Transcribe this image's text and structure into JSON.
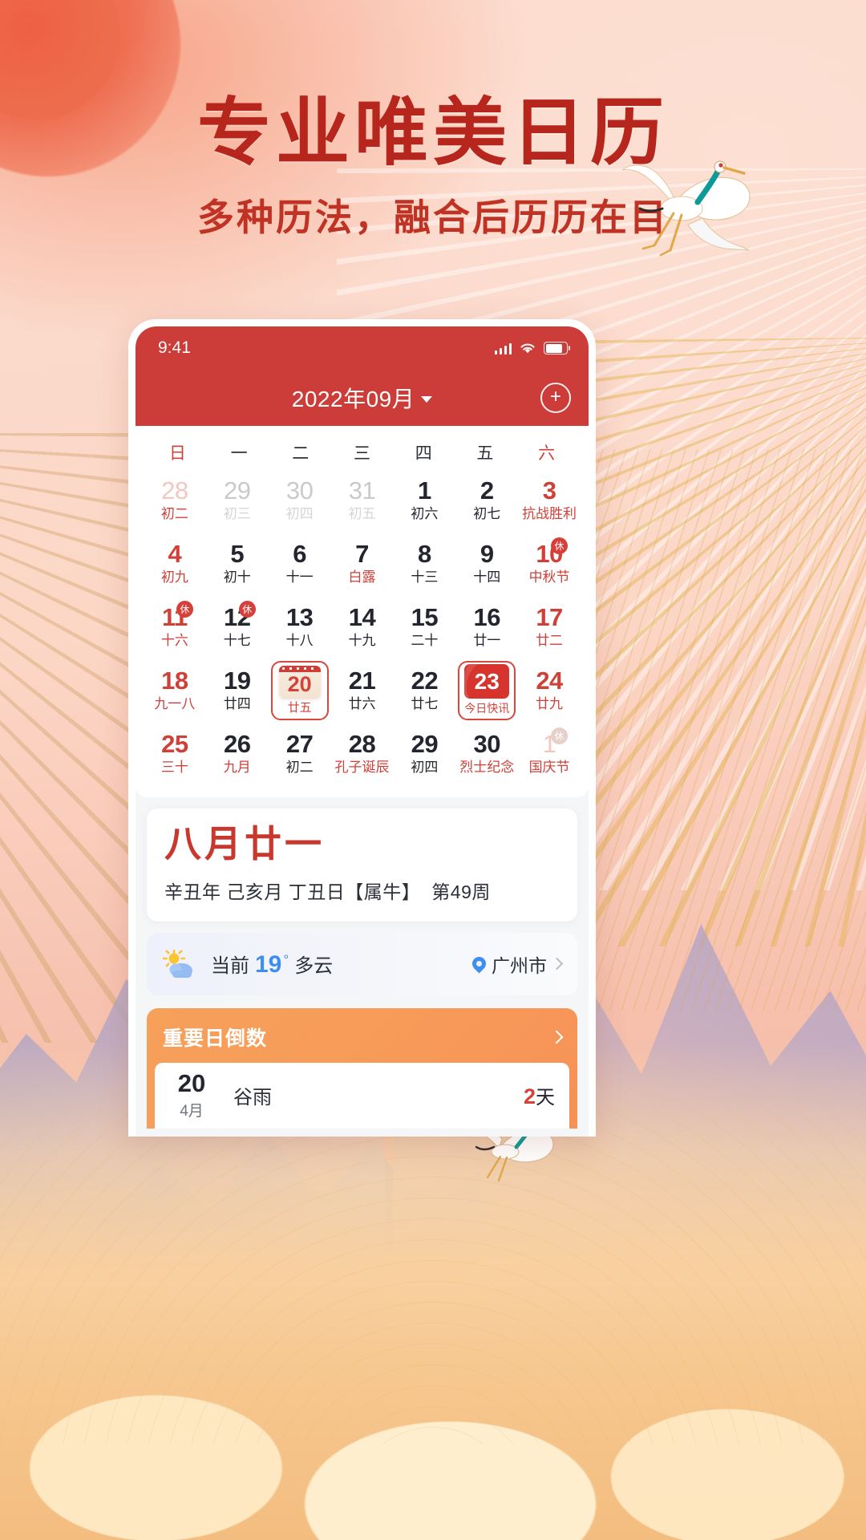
{
  "poster": {
    "headline": "专业唯美日历",
    "subhead": "多种历法，融合后历历在目",
    "colors": {
      "title_red": "#b7261d",
      "brand_red": "#cc3c39",
      "accent_orange": "#f79b59"
    }
  },
  "statusbar": {
    "time": "9:41",
    "signal_icon": "signal-bars-icon",
    "wifi_icon": "wifi-icon",
    "battery_icon": "battery-icon"
  },
  "navbar": {
    "title": "2022年09月",
    "caret_icon": "chevron-down-icon",
    "add_icon": "plus-circle-icon"
  },
  "weekdays": [
    {
      "label": "日",
      "weekend": true
    },
    {
      "label": "一",
      "weekend": false
    },
    {
      "label": "二",
      "weekend": false
    },
    {
      "label": "三",
      "weekend": false
    },
    {
      "label": "四",
      "weekend": false
    },
    {
      "label": "五",
      "weekend": false
    },
    {
      "label": "六",
      "weekend": true
    }
  ],
  "days": [
    {
      "d": "28",
      "l": "初二",
      "out": true,
      "red": true
    },
    {
      "d": "29",
      "l": "初三",
      "out": true
    },
    {
      "d": "30",
      "l": "初四",
      "out": true
    },
    {
      "d": "31",
      "l": "初五",
      "out": true
    },
    {
      "d": "1",
      "l": "初六"
    },
    {
      "d": "2",
      "l": "初七"
    },
    {
      "d": "3",
      "l": "抗战胜利",
      "red": true
    },
    {
      "d": "4",
      "l": "初九",
      "red": true
    },
    {
      "d": "5",
      "l": "初十"
    },
    {
      "d": "6",
      "l": "十一"
    },
    {
      "d": "7",
      "l": "白露",
      "lunar_red": true
    },
    {
      "d": "8",
      "l": "十三"
    },
    {
      "d": "9",
      "l": "十四"
    },
    {
      "d": "10",
      "l": "中秋节",
      "red": true,
      "badge": "休"
    },
    {
      "d": "11",
      "l": "十六",
      "red": true,
      "badge": "休"
    },
    {
      "d": "12",
      "l": "十七",
      "badge": "休"
    },
    {
      "d": "13",
      "l": "十八"
    },
    {
      "d": "14",
      "l": "十九"
    },
    {
      "d": "15",
      "l": "二十"
    },
    {
      "d": "16",
      "l": "廿一"
    },
    {
      "d": "17",
      "l": "廿二",
      "red": true
    },
    {
      "d": "18",
      "l": "九一八",
      "red": true
    },
    {
      "d": "19",
      "l": "廿四"
    },
    {
      "d": "20",
      "l": "廿五",
      "selected": true
    },
    {
      "d": "21",
      "l": "廿六"
    },
    {
      "d": "22",
      "l": "廿七"
    },
    {
      "d": "23",
      "l": "今日快讯",
      "today": true
    },
    {
      "d": "24",
      "l": "廿九",
      "red": true
    },
    {
      "d": "25",
      "l": "三十",
      "red": true
    },
    {
      "d": "26",
      "l": "九月",
      "lunar_red": true
    },
    {
      "d": "27",
      "l": "初二"
    },
    {
      "d": "28",
      "l": "孔子诞辰",
      "lunar_red": true
    },
    {
      "d": "29",
      "l": "初四"
    },
    {
      "d": "30",
      "l": "烈士纪念",
      "lunar_red": true
    },
    {
      "d": "1",
      "l": "国庆节",
      "out": true,
      "red": true,
      "badge": "休",
      "badge_gray": true
    }
  ],
  "lunar_card": {
    "big": "八月廿一",
    "sub": "辛丑年 己亥月 丁丑日【属牛】",
    "week": "第49周"
  },
  "weather_card": {
    "icon": "sun-cloud-icon",
    "prefix": "当前",
    "temp": "19",
    "degree": "°",
    "condition": "多云",
    "location_icon": "location-pin-icon",
    "location": "广州市",
    "chevron_icon": "chevron-right-icon"
  },
  "countdown_card": {
    "title": "重要日倒数",
    "chevron_icon": "chevron-right-icon",
    "items": [
      {
        "day": "20",
        "month": "4月",
        "name": "谷雨",
        "left": "2",
        "left_unit": "天"
      }
    ]
  }
}
